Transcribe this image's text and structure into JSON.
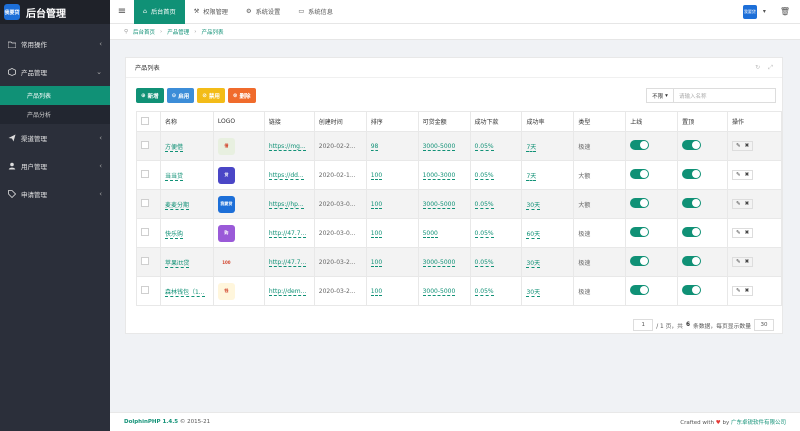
{
  "app": {
    "title": "后台管理",
    "logo_text": "我要贷"
  },
  "sidebar": {
    "items": [
      {
        "label": "常用操作",
        "icon": "folder-icon"
      },
      {
        "label": "产品管理",
        "icon": "box-icon",
        "open": true,
        "children": [
          {
            "label": "产品列表",
            "active": true
          },
          {
            "label": "产品分析"
          }
        ]
      },
      {
        "label": "渠道管理",
        "icon": "send-icon"
      },
      {
        "label": "用户管理",
        "icon": "user-icon"
      },
      {
        "label": "申请管理",
        "icon": "tag-icon"
      }
    ]
  },
  "topbar": {
    "tabs": [
      {
        "label": "后台首页",
        "icon": "home-icon",
        "active": true
      },
      {
        "label": "权限管理",
        "icon": "wrench-icon"
      },
      {
        "label": "系统设置",
        "icon": "gear-icon"
      },
      {
        "label": "系统信息",
        "icon": "monitor-icon"
      }
    ]
  },
  "breadcrumb": {
    "items": [
      "后台首页",
      "产品管理",
      "产品列表"
    ]
  },
  "panel": {
    "title": "产品列表"
  },
  "toolbar": {
    "add": "新增",
    "enable": "启用",
    "disable": "禁用",
    "delete": "删除"
  },
  "filter": {
    "select": "不限",
    "placeholder": "请输入名称"
  },
  "table": {
    "columns": [
      "名称",
      "LOGO",
      "链接",
      "创建时间",
      "排序",
      "可贷金额",
      "成功下款",
      "成功率",
      "类型",
      "上线",
      "置顶",
      "操作"
    ],
    "rows": [
      {
        "name": "方便借",
        "logo": "借",
        "logo_color": "#e8f0e0",
        "link": "https://mg...",
        "created": "2020-02-2...",
        "sort": "98",
        "amount": "3000-5000",
        "success": "0.05%",
        "rate": "7天",
        "type": "极速"
      },
      {
        "name": "当当贷",
        "logo": "贷",
        "logo_color": "#4a46c6",
        "link": "https://dd...",
        "created": "2020-02-1...",
        "sort": "100",
        "amount": "1000-3000",
        "success": "0.05%",
        "rate": "7天",
        "type": "大额"
      },
      {
        "name": "麦麦分期",
        "logo": "我要贷",
        "logo_color": "#1d6fd8",
        "link": "https://hp...",
        "created": "2020-03-0...",
        "sort": "100",
        "amount": "3000-5000",
        "success": "0.05%",
        "rate": "30天",
        "type": "大额"
      },
      {
        "name": "快乐购",
        "logo": "购",
        "logo_color": "#9a5ad8",
        "link": "http://47.7...",
        "created": "2020-03-0...",
        "sort": "100",
        "amount": "5000",
        "success": "0.05%",
        "rate": "60天",
        "type": "极速"
      },
      {
        "name": "苹果itt贷",
        "logo": "100",
        "logo_color": "#f3f3f3",
        "link": "http://47.7...",
        "created": "2020-03-2...",
        "sort": "100",
        "amount": "3000-5000",
        "success": "0.05%",
        "rate": "30天",
        "type": "极速"
      },
      {
        "name": "森林钱包（1...",
        "logo": "钱",
        "logo_color": "#fff6dc",
        "link": "http://dem...",
        "created": "2020-03-2...",
        "sort": "100",
        "amount": "3000-5000",
        "success": "0.05%",
        "rate": "30天",
        "type": "极速"
      }
    ]
  },
  "pagination": {
    "page": "1",
    "summary": "/ 1 页，共",
    "count": "6",
    "summary2": "条数据，每页显示数量",
    "per_page": "30"
  },
  "footer": {
    "brand": "DolphinPHP 1.4.5",
    "copy": "© 2015-21",
    "crafted": "Crafted with",
    "by": "by",
    "company": "广东卓锐软件有限公司"
  },
  "colors": {
    "accent": "#109176",
    "sidebar": "#2b2f3a"
  }
}
